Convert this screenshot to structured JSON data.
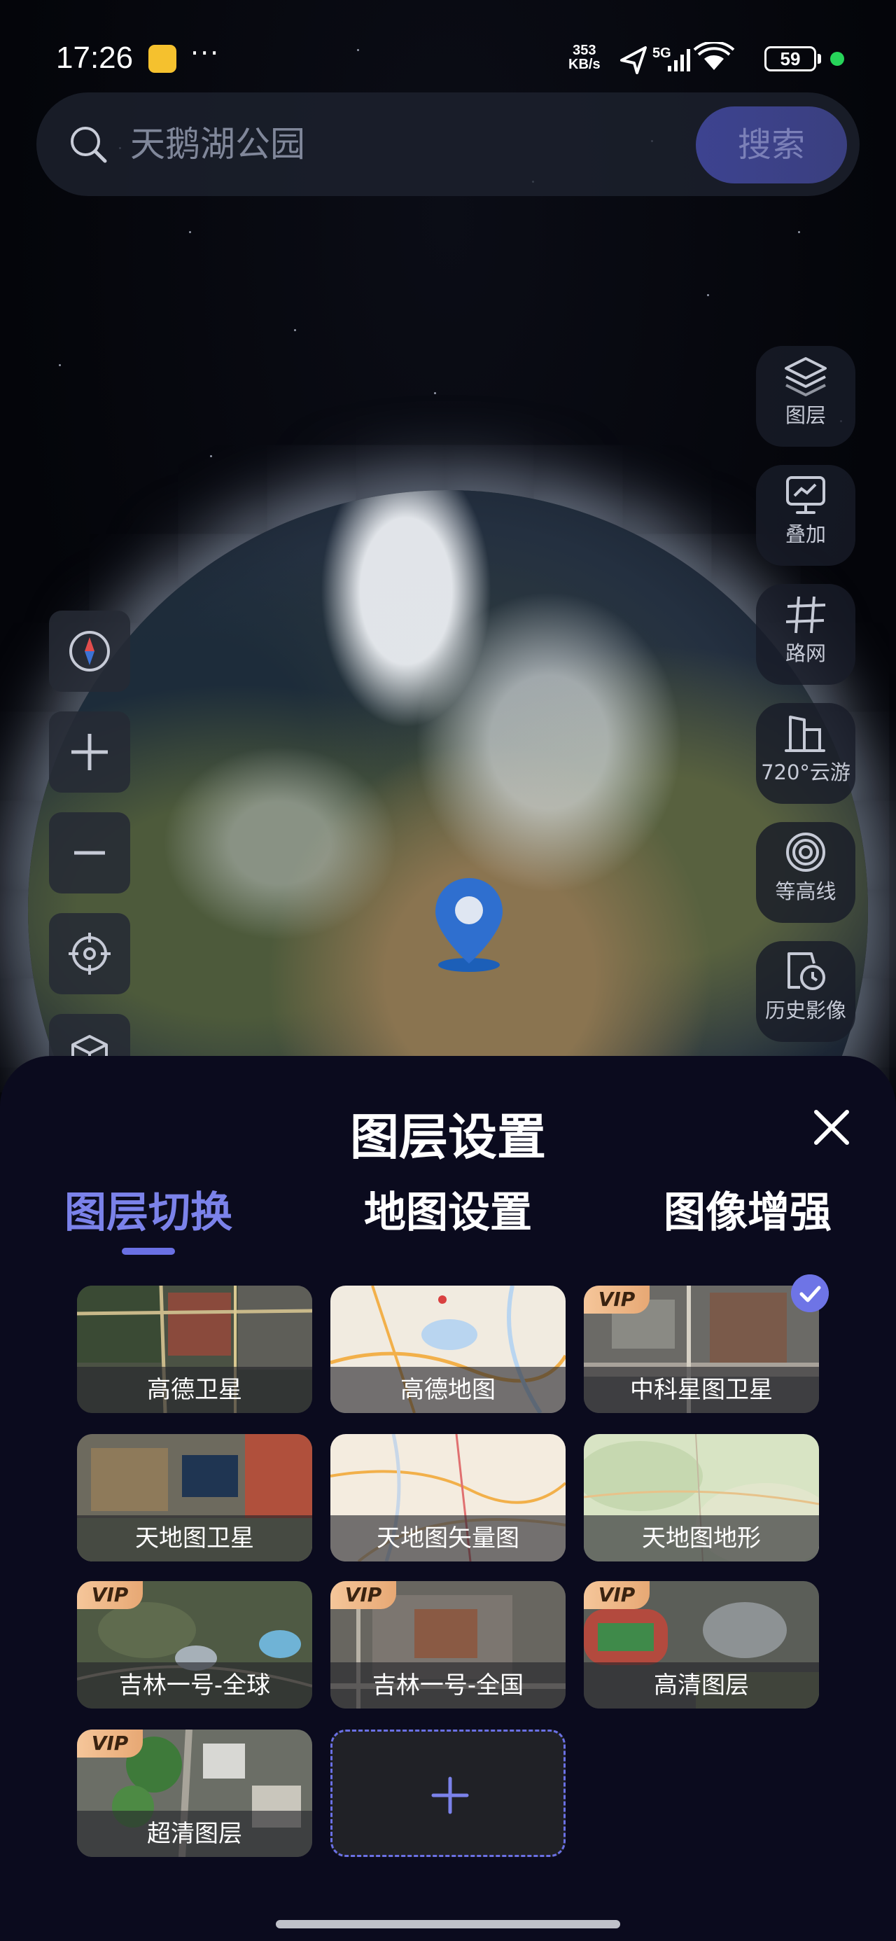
{
  "status_bar": {
    "time": "17:26",
    "network_speed_value": "353",
    "network_speed_unit": "KB/s",
    "network_type": "5G",
    "battery": "59"
  },
  "search": {
    "placeholder": "天鹅湖公园",
    "button_label": "搜索"
  },
  "right_tools": [
    {
      "label": "图层",
      "icon": "layers-icon"
    },
    {
      "label": "叠加",
      "icon": "overlay-icon"
    },
    {
      "label": "路网",
      "icon": "road-network-icon"
    },
    {
      "label": "720°云游",
      "icon": "building-icon"
    },
    {
      "label": "等高线",
      "icon": "contour-icon"
    },
    {
      "label": "历史影像",
      "icon": "history-icon"
    }
  ],
  "left_tools": [
    "compass-icon",
    "zoom-in-icon",
    "zoom-out-icon",
    "locate-icon",
    "3d-cube-icon"
  ],
  "panel": {
    "title": "图层设置",
    "tabs": [
      {
        "label": "图层切换",
        "active": true
      },
      {
        "label": "地图设置",
        "active": false
      },
      {
        "label": "图像增强",
        "active": false
      }
    ],
    "layers": [
      {
        "name": "高德卫星",
        "vip": false,
        "selected": false
      },
      {
        "name": "高德地图",
        "vip": false,
        "selected": false
      },
      {
        "name": "中科星图卫星",
        "vip": true,
        "selected": true
      },
      {
        "name": "天地图卫星",
        "vip": false,
        "selected": false
      },
      {
        "name": "天地图矢量图",
        "vip": false,
        "selected": false
      },
      {
        "name": "天地图地形",
        "vip": false,
        "selected": false
      },
      {
        "name": "吉林一号-全球",
        "vip": true,
        "selected": false
      },
      {
        "name": "吉林一号-全国",
        "vip": true,
        "selected": false
      },
      {
        "name": "高清图层",
        "vip": true,
        "selected": false
      },
      {
        "name": "超清图层",
        "vip": true,
        "selected": false
      }
    ],
    "vip_badge": "VIP"
  },
  "colors": {
    "accent": "#6a70e4",
    "sheet_bg": "#0b0b1e",
    "vip_badge": "#efb887"
  }
}
